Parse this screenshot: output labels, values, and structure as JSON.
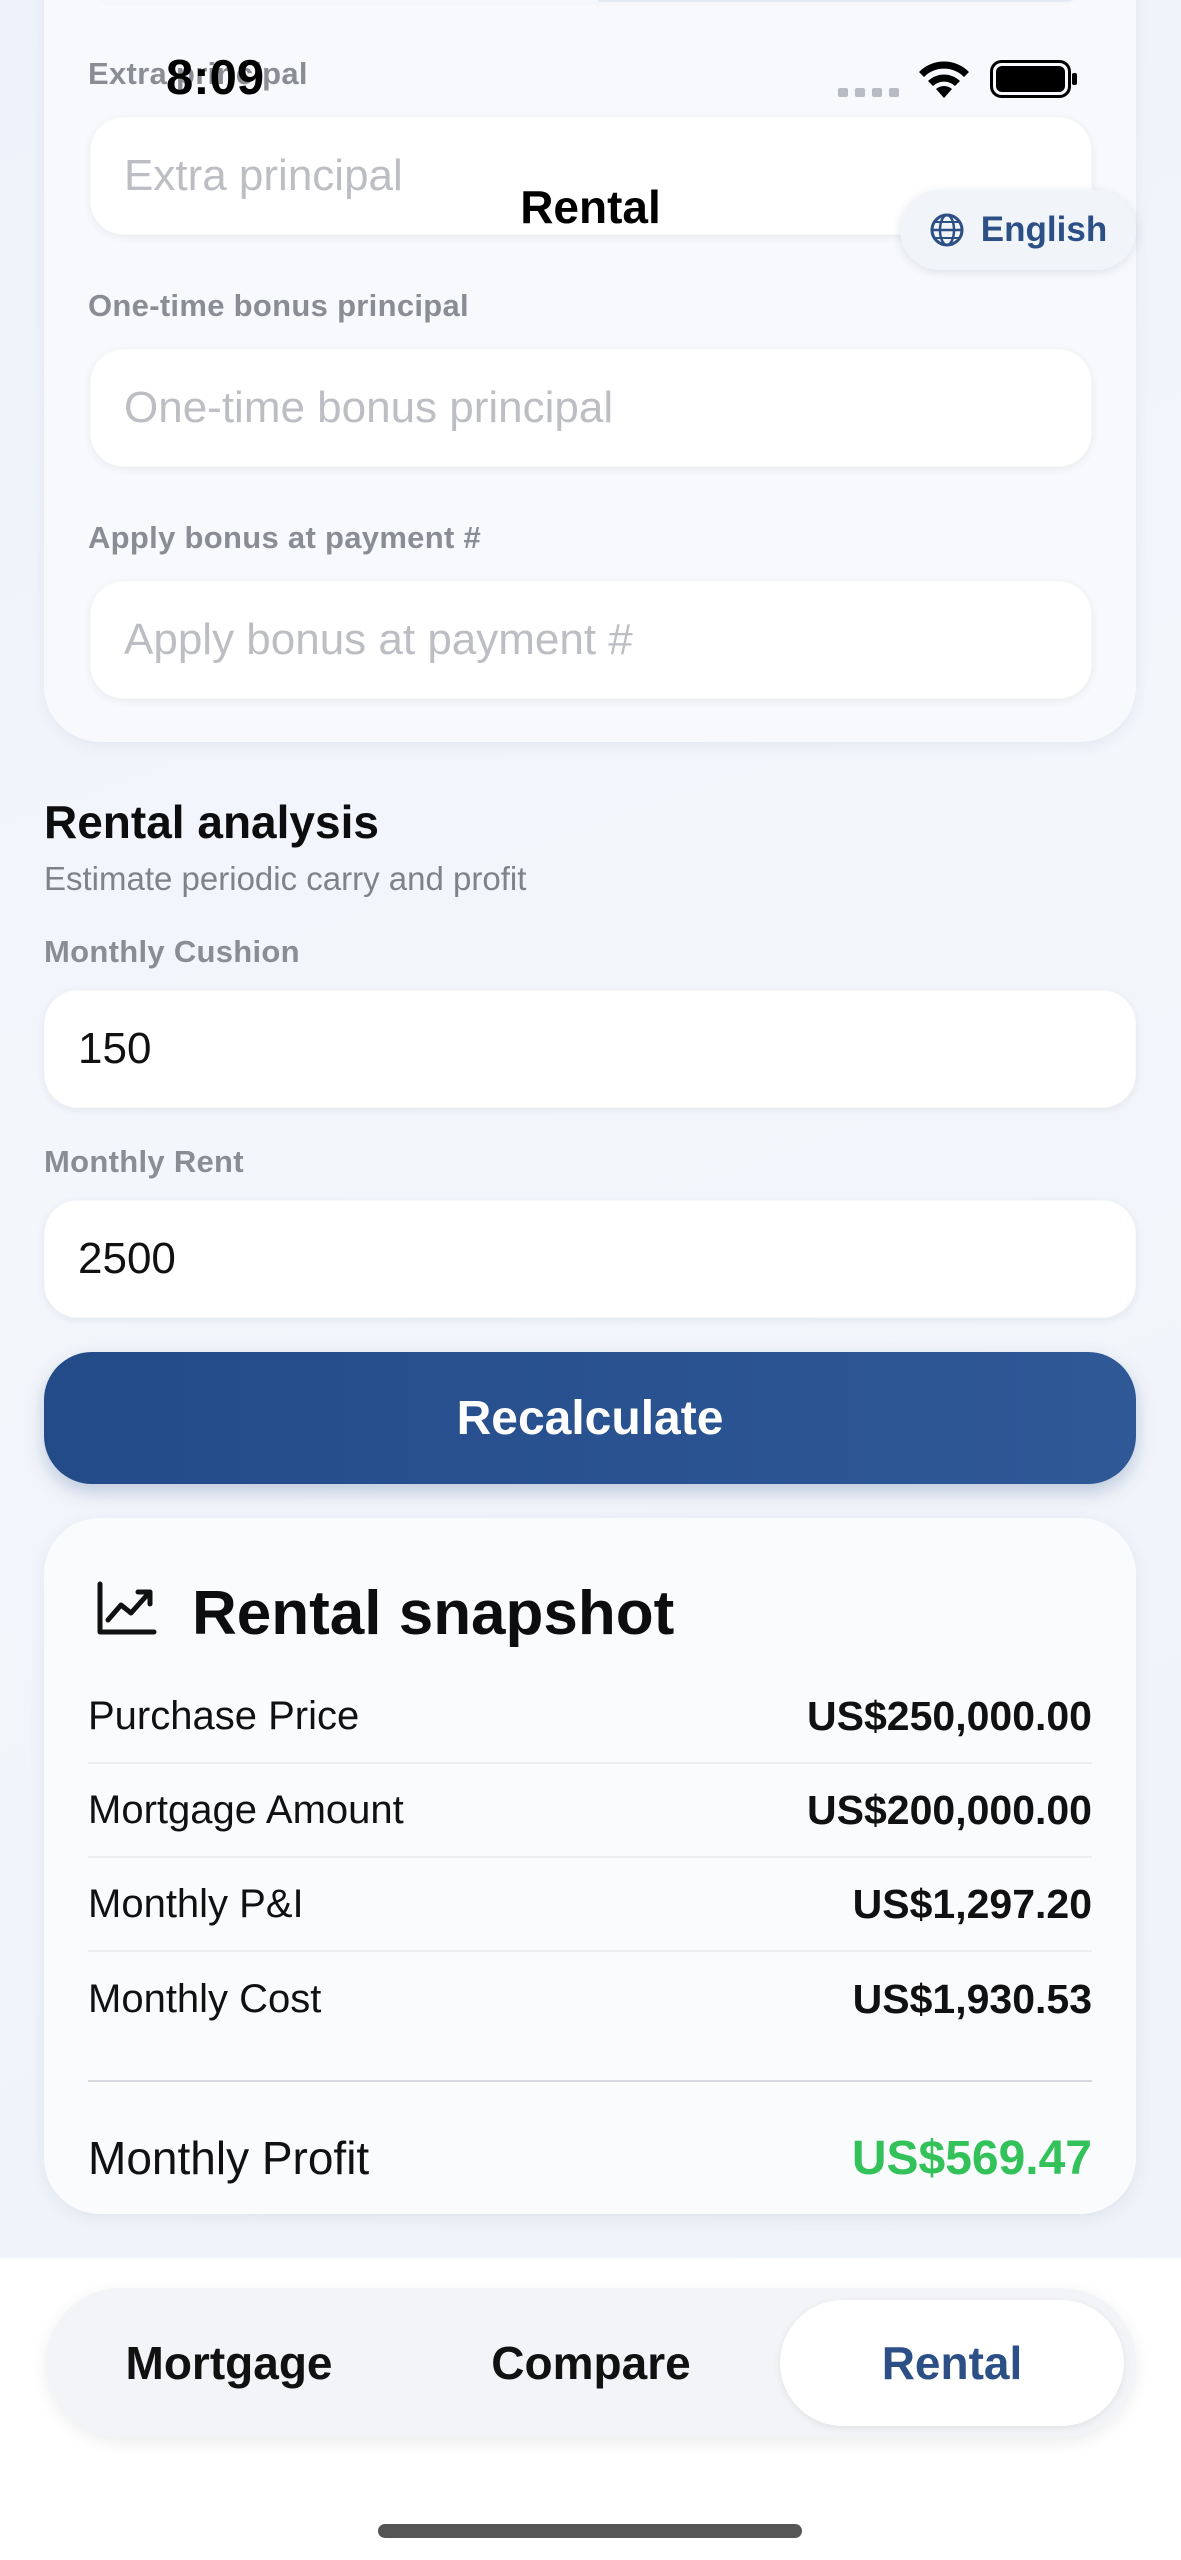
{
  "status_bar": {
    "time": "8:09"
  },
  "nav": {
    "title": "Rental",
    "language_label": "English"
  },
  "form": {
    "extra_principal": {
      "label": "Extra principal",
      "placeholder": "Extra principal",
      "value": ""
    },
    "bonus_principal": {
      "label": "One-time bonus principal",
      "placeholder": "One-time bonus principal",
      "value": ""
    },
    "bonus_payment": {
      "label": "Apply bonus at payment #",
      "placeholder": "Apply bonus at payment #",
      "value": ""
    }
  },
  "rental": {
    "title": "Rental analysis",
    "subtitle": "Estimate periodic carry and profit",
    "cushion": {
      "label": "Monthly Cushion",
      "value": "150"
    },
    "rent": {
      "label": "Monthly Rent",
      "value": "2500"
    },
    "recalculate_label": "Recalculate"
  },
  "snapshot": {
    "title": "Rental snapshot",
    "rows": [
      {
        "label": "Purchase Price",
        "value": "US$250,000.00"
      },
      {
        "label": "Mortgage Amount",
        "value": "US$200,000.00"
      },
      {
        "label": "Monthly P&I",
        "value": "US$1,297.20"
      },
      {
        "label": "Monthly Cost",
        "value": "US$1,930.53"
      }
    ],
    "profit": {
      "label": "Monthly Profit",
      "value": "US$569.47",
      "color": "#33c15a"
    }
  },
  "tabs": [
    {
      "label": "Mortgage"
    },
    {
      "label": "Compare"
    },
    {
      "label": "Rental",
      "active": true
    }
  ],
  "colors": {
    "accent": "#2c4f86",
    "button": "#234b88",
    "profit": "#33c15a"
  }
}
